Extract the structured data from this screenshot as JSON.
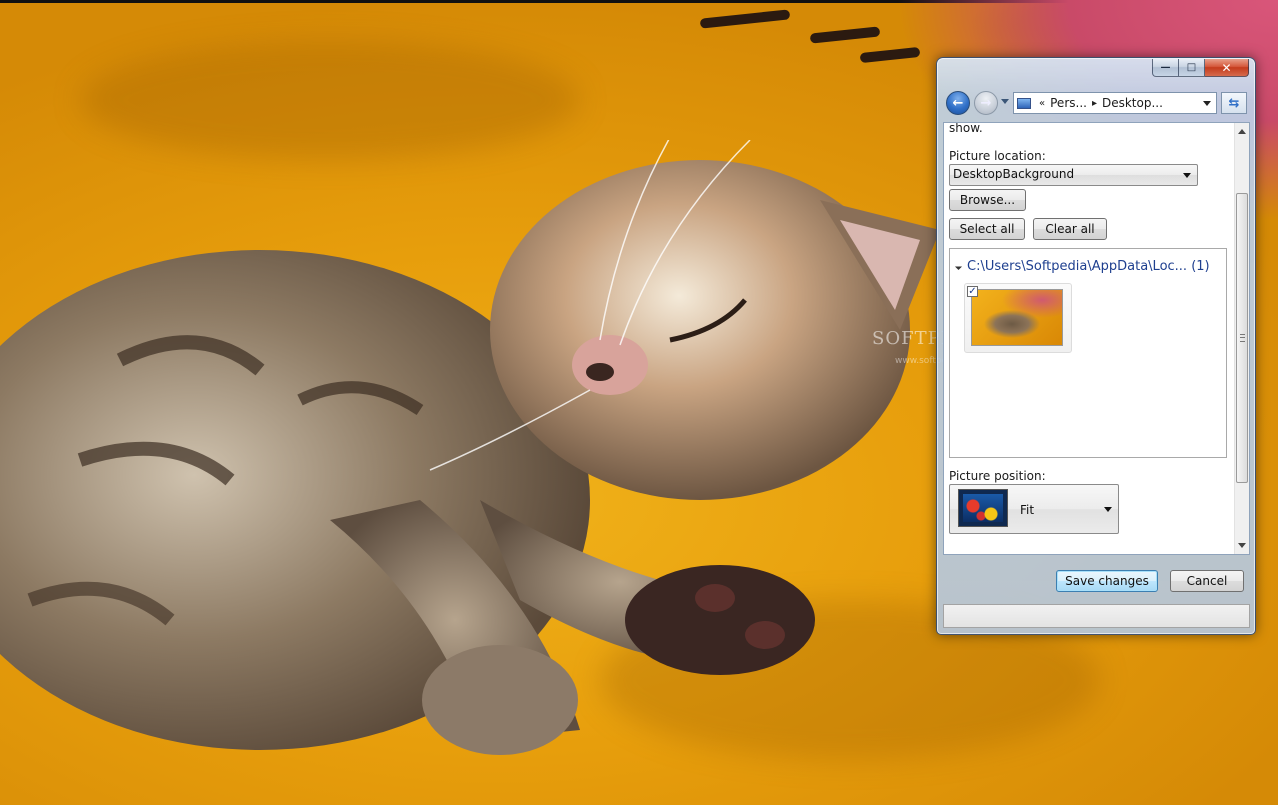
{
  "window": {
    "caption": {
      "minimize_glyph": "—",
      "maximize_glyph": "□",
      "close_glyph": "✕"
    },
    "address": {
      "overflow": "«",
      "crumbs": [
        "Pers...",
        "Desktop..."
      ],
      "separator": "▸"
    },
    "description_tail": "show.",
    "picture_location": {
      "label": "Picture location:",
      "selected": "DesktopBackground"
    },
    "buttons": {
      "browse": "Browse...",
      "select_all": "Select all",
      "clear_all": "Clear all",
      "save_changes": "Save changes",
      "cancel": "Cancel"
    },
    "picture_list": {
      "group_header": "C:\\Users\\Softpedia\\AppData\\Loc... (1)",
      "items": [
        {
          "checked": true,
          "check_glyph": "✓"
        }
      ]
    },
    "picture_position": {
      "label": "Picture position:",
      "selected": "Fit"
    }
  },
  "watermark": {
    "text": "SOFTPEDIA",
    "url": "www.softpedia.com"
  },
  "colors": {
    "accent_blue": "#2f6fc7",
    "group_header": "#1e3f8f",
    "close_red": "#c43b1c",
    "wallpaper_yellow": "#e79e0c"
  },
  "icons": {
    "back": "back-arrow-icon",
    "forward": "forward-arrow-icon",
    "refresh": "refresh-icon",
    "computer": "computer-icon"
  }
}
